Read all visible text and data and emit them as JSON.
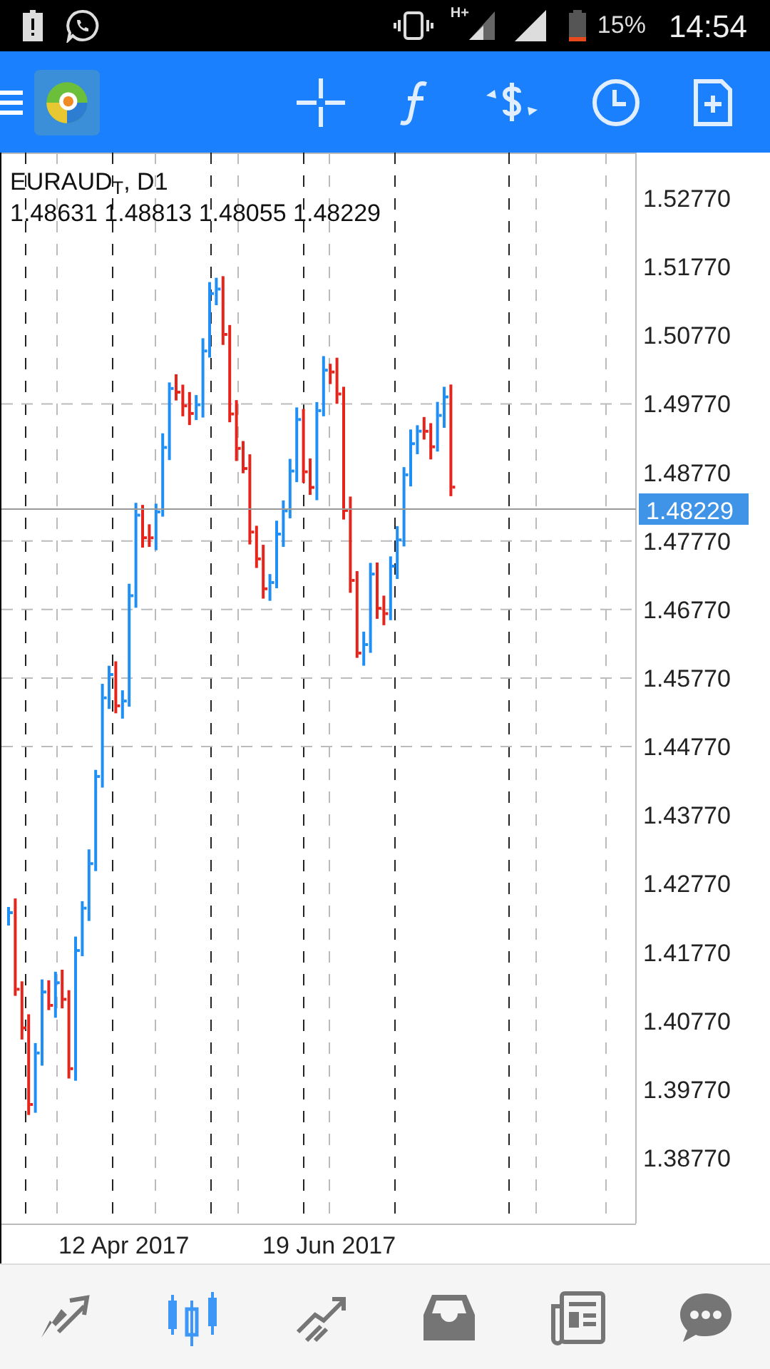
{
  "status_bar": {
    "network": "H+",
    "battery": "15%",
    "time": "14:54"
  },
  "chart": {
    "symbol": "EURAUD$_{T}$, D1",
    "ohlc": "1.48631 1.48813 1.48055 1.48229",
    "price_labels": [
      "1.52770",
      "1.51770",
      "1.50770",
      "1.49770",
      "1.48770",
      "1.47770",
      "1.46770",
      "1.45770",
      "1.44770",
      "1.43770",
      "1.42770",
      "1.41770",
      "1.40770",
      "1.39770",
      "1.38770"
    ],
    "current_price": "1.48229",
    "date_labels": [
      "12 Apr 2017",
      "19 Jun 2017"
    ]
  },
  "bottom_nav": [
    {
      "kind": "trade",
      "selected": false
    },
    {
      "kind": "chart",
      "selected": true
    },
    {
      "kind": "history",
      "selected": false
    },
    {
      "kind": "inbox",
      "selected": false
    },
    {
      "kind": "news",
      "selected": false
    },
    {
      "kind": "chat",
      "selected": false
    }
  ]
}
